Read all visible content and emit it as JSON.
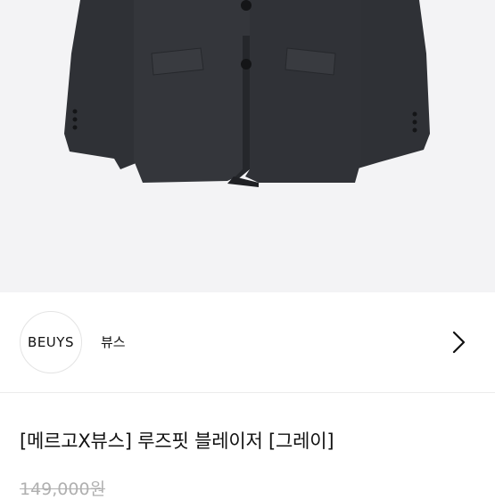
{
  "product_image": {
    "alt_icon": "blazer-image",
    "color": "#2e3035"
  },
  "brand": {
    "logo_text": "BEUYS",
    "name": "뷰스",
    "arrow_icon": "chevron-right-icon"
  },
  "product": {
    "title": "[메르고X뷰스] 루즈핏 블레이저 [그레이]",
    "original_price": "149,000원"
  }
}
